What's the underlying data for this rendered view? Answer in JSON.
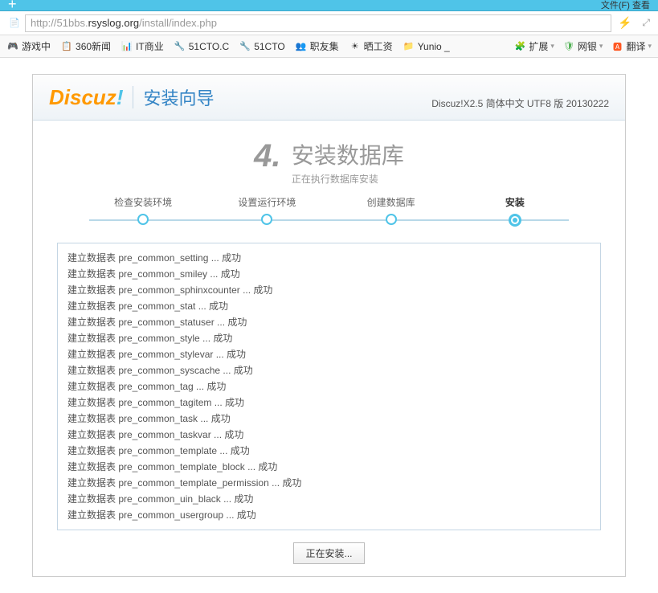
{
  "browser": {
    "top_right": "文件(F) 查看",
    "url_prefix": "http://51bbs.",
    "url_highlight": "rsyslog.org",
    "url_rest": "/install/index.php"
  },
  "bookmarks": {
    "left": [
      {
        "icon": "🎮",
        "label": "游戏中"
      },
      {
        "icon": "📋",
        "label": "360新闻"
      },
      {
        "icon": "📊",
        "label": "IT商业"
      },
      {
        "icon": "🔧",
        "label": "51CTO.C"
      },
      {
        "icon": "🔧",
        "label": "51CTO"
      },
      {
        "icon": "👥",
        "label": "职友集"
      },
      {
        "icon": "☀",
        "label": "晒工资"
      },
      {
        "icon": "📁",
        "label": "Yunio _"
      }
    ],
    "right": [
      {
        "icon": "🧩",
        "label": "扩展",
        "color": "#2196f3"
      },
      {
        "icon": "🛡",
        "label": "网银",
        "color": "#4caf50"
      },
      {
        "icon": "🅰",
        "label": "翻译",
        "color": "#ff5722"
      }
    ]
  },
  "installer": {
    "logo": {
      "text": "Discuz",
      "bang": "!"
    },
    "wizard_title": "安装向导",
    "version": "Discuz!X2.5 简体中文 UTF8 版 20130222",
    "step_number": "4.",
    "step_title": "安装数据库",
    "step_sub": "正在执行数据库安装",
    "steps": [
      {
        "label": "检查安装环境",
        "active": false
      },
      {
        "label": "设置运行环境",
        "active": false
      },
      {
        "label": "创建数据库",
        "active": false
      },
      {
        "label": "安装",
        "active": true
      }
    ],
    "log_lines": [
      "建立数据表 pre_common_setting ... 成功",
      "建立数据表 pre_common_smiley ... 成功",
      "建立数据表 pre_common_sphinxcounter ... 成功",
      "建立数据表 pre_common_stat ... 成功",
      "建立数据表 pre_common_statuser ... 成功",
      "建立数据表 pre_common_style ... 成功",
      "建立数据表 pre_common_stylevar ... 成功",
      "建立数据表 pre_common_syscache ... 成功",
      "建立数据表 pre_common_tag ... 成功",
      "建立数据表 pre_common_tagitem ... 成功",
      "建立数据表 pre_common_task ... 成功",
      "建立数据表 pre_common_taskvar ... 成功",
      "建立数据表 pre_common_template ... 成功",
      "建立数据表 pre_common_template_block ... 成功",
      "建立数据表 pre_common_template_permission ... 成功",
      "建立数据表 pre_common_uin_black ... 成功",
      "建立数据表 pre_common_usergroup ... 成功"
    ],
    "installing_label": "正在安装..."
  }
}
